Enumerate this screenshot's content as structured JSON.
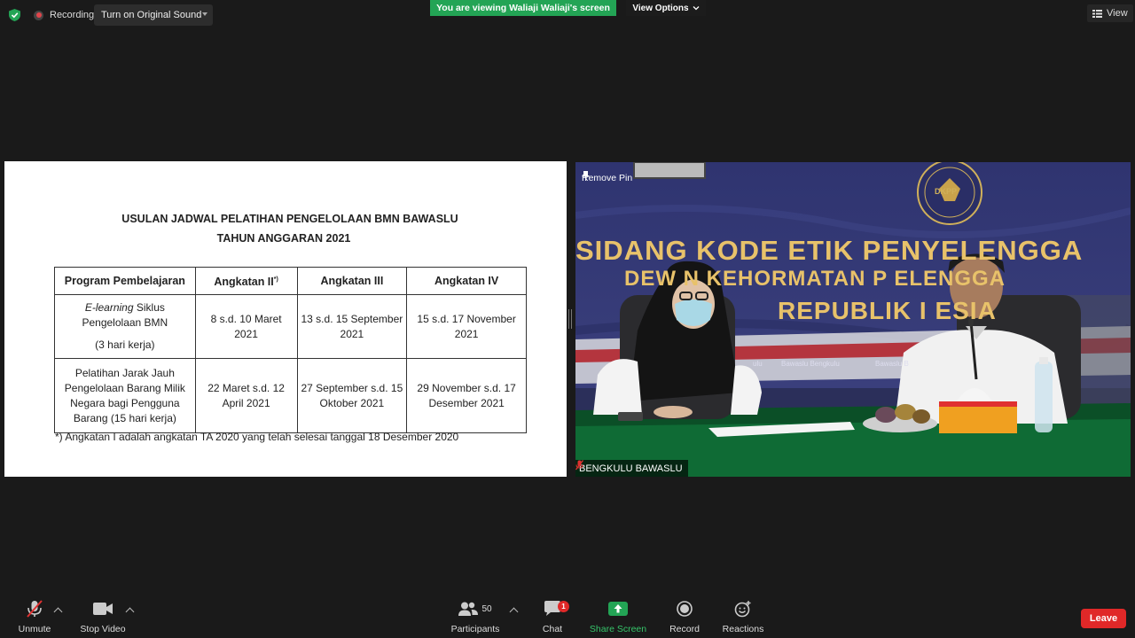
{
  "top_bar": {
    "recording_label": "Recording",
    "original_sound_label": "Turn on Original Sound",
    "viewing_banner": "You are viewing Waliaji Waliaji's screen",
    "view_options_label": "View Options",
    "view_label": "View"
  },
  "shared_screen": {
    "title_line1": "USULAN JADWAL PELATIHAN PENGELOLAAN BMN BAWASLU",
    "title_line2": "TAHUN ANGGARAN 2021",
    "table": {
      "headers": [
        "Program Pembelajaran",
        "Angkatan II",
        "Angkatan III",
        "Angkatan IV"
      ],
      "header_superscript": "*)",
      "rows": [
        {
          "program_italic": "E-learning",
          "program_rest": " Siklus Pengelolaan BMN",
          "program_note": "(3 hari kerja)",
          "angkatan_ii": "8 s.d. 10 Maret 2021",
          "angkatan_iii": "13 s.d. 15 September 2021",
          "angkatan_iv": "15 s.d. 17 November 2021"
        },
        {
          "program": "Pelatihan Jarak Jauh Pengelolaan Barang Milik Negara bagi Pengguna Barang (15 hari kerja)",
          "angkatan_ii": "22 Maret s.d. 12 April 2021",
          "angkatan_iii": "27 September s.d. 15 Oktober 2021",
          "angkatan_iv": "29 November s.d. 17 Desember 2021"
        }
      ]
    },
    "footnote": "*) Angkatan I adalah angkatan TA 2020 yang telah selesai tanggal 18 Desember 2020"
  },
  "video_tile": {
    "remove_pin_label": "Remove Pin",
    "participant_name": "BENGKULU BAWASLU",
    "banner_line1": "SIDANG KODE ETIK PENYELENGGA",
    "banner_line2": "DEW  N KEHORMATAN P    ELENGGA",
    "banner_line3": "REPUBLIK I      ESIA",
    "banner_small1": "Bawaslu Bengkulu",
    "banner_small2": "Bawaslu B",
    "banner_small3": "ulu",
    "logo_text": "DKPP"
  },
  "toolbar": {
    "unmute_label": "Unmute",
    "stop_video_label": "Stop Video",
    "participants_label": "Participants",
    "participants_count": "50",
    "chat_label": "Chat",
    "chat_badge": "1",
    "share_screen_label": "Share Screen",
    "record_label": "Record",
    "reactions_label": "Reactions",
    "leave_label": "Leave"
  },
  "colors": {
    "background": "#1a1a1a",
    "viewing_banner": "#23a455",
    "leave_button": "#e02828",
    "share_green": "#23a455"
  }
}
